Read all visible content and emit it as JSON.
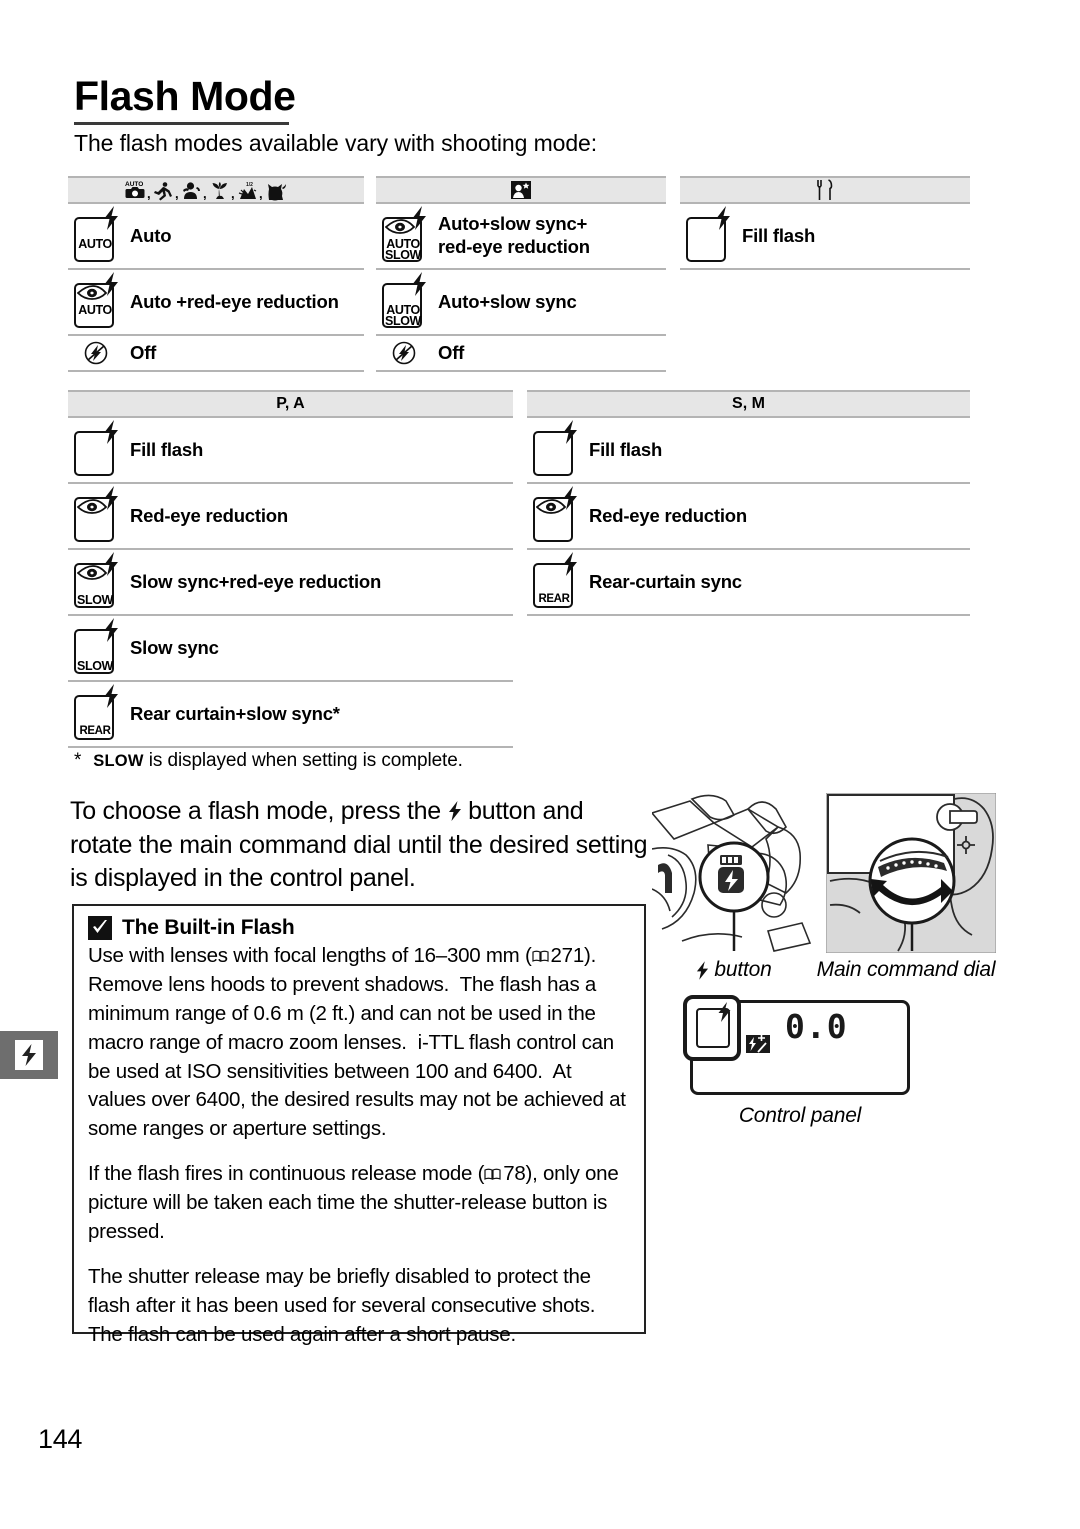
{
  "page": {
    "number": "144",
    "chapter_tab_icon": "flash-icon"
  },
  "heading": {
    "title": "Flash Mode",
    "subtitle": "The flash modes available vary with shooting mode:"
  },
  "tables": [
    {
      "id": "scene-modes",
      "header_icons": [
        "auto-camera-icon",
        "sports-icon",
        "portrait-icon",
        "close-up-icon",
        "night-portrait-icon",
        "pet-portrait-icon"
      ],
      "header_label": "",
      "rows": [
        {
          "icon": "flash-auto-icon",
          "icon_word": "AUTO",
          "eye": false,
          "label": "Auto"
        },
        {
          "icon": "flash-auto-redeye-icon",
          "icon_word": "AUTO",
          "eye": true,
          "label": "Auto +red-eye reduction"
        },
        {
          "icon": "flash-off-icon",
          "icon_word": "",
          "eye": false,
          "label": "Off"
        }
      ]
    },
    {
      "id": "night-portrait-mode",
      "header_icons": [
        "night-portrait-icon"
      ],
      "header_label": "",
      "rows": [
        {
          "icon": "flash-auto-slow-redeye-icon",
          "icon_word": "AUTO",
          "icon_word2": "SLOW",
          "eye": true,
          "label_line1": "Auto+slow sync+",
          "label_line2": "red-eye reduction"
        },
        {
          "icon": "flash-auto-slow-icon",
          "icon_word": "AUTO",
          "icon_word2": "SLOW",
          "eye": false,
          "label": "Auto+slow sync"
        },
        {
          "icon": "flash-off-icon",
          "icon_word": "",
          "eye": false,
          "label": "Off"
        }
      ]
    },
    {
      "id": "food-mode",
      "header_icons": [
        "food-icon"
      ],
      "header_label": "",
      "rows": [
        {
          "icon": "flash-fill-icon",
          "icon_word": "",
          "eye": false,
          "label": "Fill flash"
        }
      ]
    },
    {
      "id": "p-a-modes",
      "header_icons": [],
      "header_label": "P, A",
      "rows": [
        {
          "icon": "flash-fill-icon",
          "icon_word": "",
          "eye": false,
          "label": "Fill flash"
        },
        {
          "icon": "flash-redeye-icon",
          "icon_word": "",
          "eye": true,
          "label": "Red-eye reduction"
        },
        {
          "icon": "flash-slow-redeye-icon",
          "icon_word": "SLOW",
          "eye": true,
          "label": "Slow sync+red-eye reduction"
        },
        {
          "icon": "flash-slow-icon",
          "icon_word": "SLOW",
          "eye": false,
          "label": "Slow sync"
        },
        {
          "icon": "flash-rear-icon",
          "icon_word": "REAR",
          "eye": false,
          "label": "Rear curtain+slow sync*"
        }
      ]
    },
    {
      "id": "s-m-modes",
      "header_icons": [],
      "header_label": "S, M",
      "rows": [
        {
          "icon": "flash-fill-icon",
          "icon_word": "",
          "eye": false,
          "label": "Fill flash"
        },
        {
          "icon": "flash-redeye-icon",
          "icon_word": "",
          "eye": true,
          "label": "Red-eye reduction"
        },
        {
          "icon": "flash-rear-icon",
          "icon_word": "REAR",
          "eye": false,
          "label": "Rear-curtain sync"
        }
      ]
    }
  ],
  "footnote": {
    "marker": "*",
    "bold_term": "SLOW",
    "text": " is displayed when setting is complete."
  },
  "body_paragraph": {
    "part1": "To choose a flash mode, press the ",
    "icon": "flash-bolt-icon",
    "part2": " button and rotate the main command dial until the desired setting is displayed in the control panel."
  },
  "note_box": {
    "icon": "caution-check-icon",
    "title": "The Built-in Flash",
    "paragraphs": [
      "Use with lenses with focal lengths of 16–300 mm ( 271). Remove lens hoods to prevent shadows.  The flash has a minimum range of 0.6 m (2 ft.) and can not be used in the macro range of macro zoom lenses.  i-TTL flash control can be used at ISO sensitivities between 100 and 6400.  At values over 6400, the desired results may not be achieved at some ranges or aperture settings.",
      "If the flash fires in continuous release mode ( 78), only one picture will be taken each time the shutter-release button is pressed.",
      "The shutter release may be briefly disabled to protect the flash after it has been used for several consecutive shots. The flash can be used again after a short pause."
    ],
    "ref_page_1": "271",
    "ref_page_2": "78"
  },
  "illustrations": {
    "photo_a": "camera-flash-button-photo",
    "photo_b": "camera-main-command-dial-photo",
    "caption_a_icon": "flash-bolt-icon",
    "caption_a": "button",
    "caption_b": "Main command dial",
    "control_panel": {
      "value": "0.0",
      "flash_icon": "flash-mode-indicator-icon",
      "comp_icon": "flash-compensation-icon",
      "caption": "Control panel"
    }
  },
  "colors": {
    "header_fill": "#e6e6e6",
    "rule": "#b4b4b4",
    "tab_bg": "#6e6e6e",
    "ink": "#000000"
  }
}
